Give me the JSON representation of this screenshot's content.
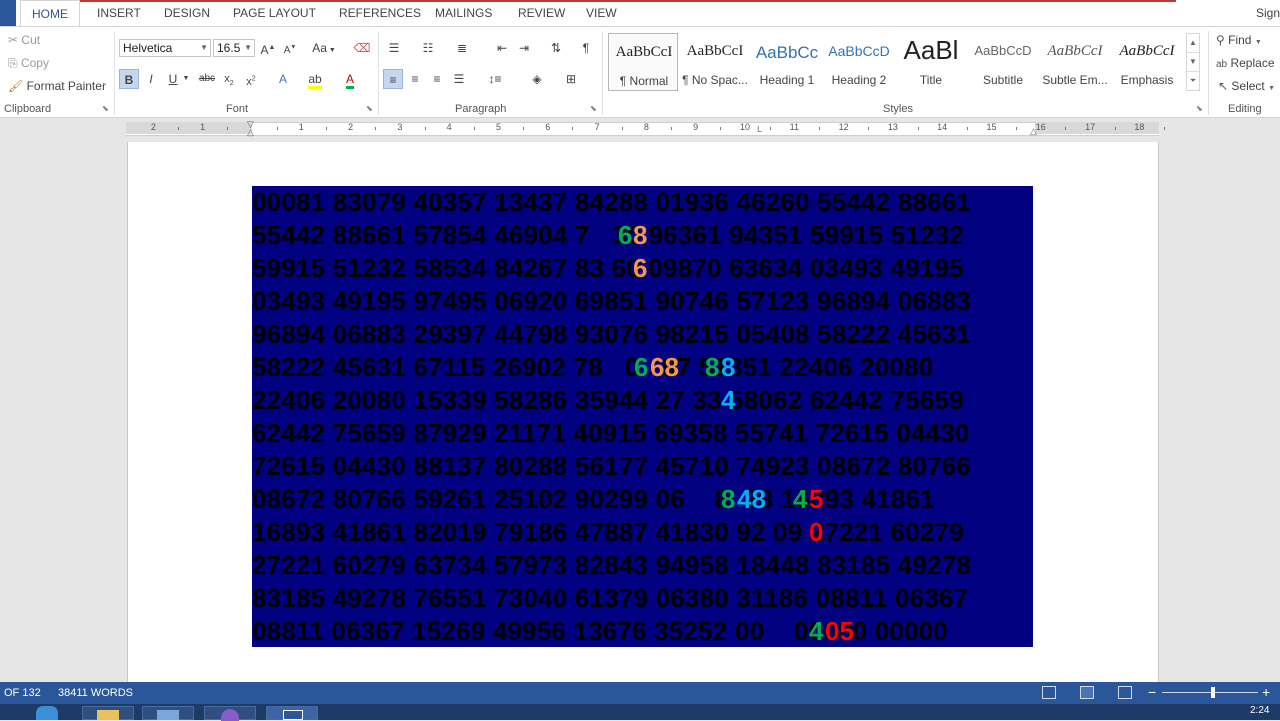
{
  "window": {
    "signin": "Sign"
  },
  "tabs": [
    "HOME",
    "INSERT",
    "DESIGN",
    "PAGE LAYOUT",
    "REFERENCES",
    "MAILINGS",
    "REVIEW",
    "VIEW"
  ],
  "clipboard": {
    "cut": "Cut",
    "copy": "Copy",
    "format_painter": "Format Painter",
    "label": "Clipboard"
  },
  "font": {
    "family": "Helvetica",
    "size": "16.5",
    "label": "Font",
    "case_button": "Aa"
  },
  "paragraph": {
    "label": "Paragraph"
  },
  "styles": {
    "label": "Styles",
    "items": [
      {
        "sample": "AaBbCcI",
        "name": "¶ Normal"
      },
      {
        "sample": "AaBbCcI",
        "name": "¶ No Spac..."
      },
      {
        "sample": "AaBbCc",
        "name": "Heading 1"
      },
      {
        "sample": "AaBbCcD",
        "name": "Heading 2"
      },
      {
        "sample": "AaBl",
        "name": "Title"
      },
      {
        "sample": "AaBbCcD",
        "name": "Subtitle"
      },
      {
        "sample": "AaBbCcI",
        "name": "Subtle Em..."
      },
      {
        "sample": "AaBbCcI",
        "name": "Emphasis"
      }
    ]
  },
  "editing": {
    "find": "Find",
    "replace": "Replace",
    "select": "Select",
    "label": "Editing"
  },
  "ruler": {
    "numbers": [
      "2",
      "1",
      "1",
      "2",
      "3",
      "4",
      "5",
      "6",
      "7",
      "8",
      "9",
      "10",
      "11",
      "12",
      "13",
      "14",
      "15",
      "16",
      "17",
      "18"
    ]
  },
  "document": {
    "rows": [
      "00081 83079 40357 13437 84288 01936 46260 55442 88661",
      "55442 88661 57854 46904 7   30 96361 94351 59915 51232",
      "59915 51232 58534 84267 83 60 09870 63634 03493 49195",
      "03493 49195 97495 06920 69851 90746 57123 96894 06883",
      "96894 06883 29397 44798 93076 98215 05408 58222 45631",
      "58222 45631 67115 26902 78   0   97 51351 22406 20080",
      "22406 20080 15339 58286 35944 27 33 58062 62442 75659",
      "62442 75659 87929 21171 40915 69358 55741 72615 04430",
      "72615 04430 88137 80288 56177 45710 74923 08672 80766",
      "08672 80766 59261 25102 90299 06    8  28 16893 41861",
      "16893 41861 82019 79186 47887 41830 92 09 27221 60279",
      "27221 60279 63734 57973 82843 94958 18448 83185 49278",
      "83185 49278 76551 73040 61379 06380 31186 08811 06367",
      "08811 06367 15269 49956 13676 35252 00    00000 00000"
    ],
    "highlights": [
      {
        "text": "6",
        "color": "#00b050"
      },
      {
        "text": "8",
        "color": "#f79646"
      },
      {
        "text": "6",
        "color": "#f79646"
      },
      {
        "text": "6",
        "color": "#00b050"
      },
      {
        "text": "68",
        "color": "#f79646"
      },
      {
        "text": "8",
        "color": "#00b050"
      },
      {
        "text": "8",
        "color": "#00b0f0"
      },
      {
        "text": "4",
        "color": "#00b0f0"
      },
      {
        "text": "8",
        "color": "#00b050"
      },
      {
        "text": "48",
        "color": "#00b0f0"
      },
      {
        "text": "4",
        "color": "#00b050"
      },
      {
        "text": "5",
        "color": "#ff0000"
      },
      {
        "text": "0",
        "color": "#ff0000"
      },
      {
        "text": "4",
        "color": "#00b050"
      },
      {
        "text": "05",
        "color": "#ff0000"
      }
    ],
    "background_color": "#000080"
  },
  "status": {
    "page": "OF 132",
    "words": "38411 WORDS"
  },
  "taskbar": {
    "time": "2:24"
  }
}
